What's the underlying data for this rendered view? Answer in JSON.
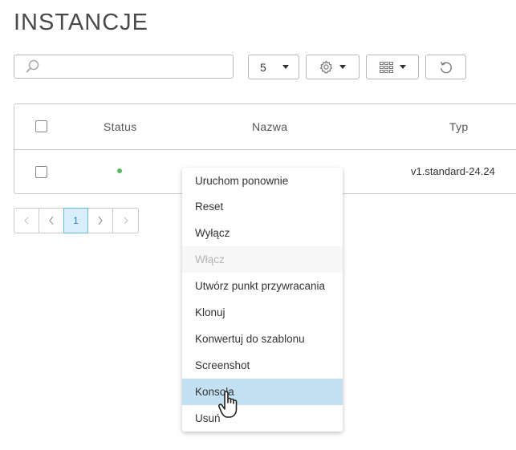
{
  "page": {
    "title": "INSTANCJE"
  },
  "toolbar": {
    "search_placeholder": "",
    "page_size": "5",
    "icons": [
      "search-icon",
      "gear-icon",
      "columns-icon",
      "refresh-icon"
    ]
  },
  "table": {
    "headers": [
      "Status",
      "Nazwa",
      "Typ"
    ],
    "rows": [
      {
        "status": "green",
        "name": "",
        "type": "v1.standard-24.24"
      }
    ]
  },
  "pagination": {
    "current": "1"
  },
  "menu": {
    "items": [
      {
        "label": "Uruchom ponownie",
        "state": "enabled"
      },
      {
        "label": "Reset",
        "state": "enabled"
      },
      {
        "label": "Wyłącz",
        "state": "enabled"
      },
      {
        "label": "Włącz",
        "state": "disabled"
      },
      {
        "label": "Utwórz punkt przywracania",
        "state": "enabled"
      },
      {
        "label": "Klonuj",
        "state": "enabled"
      },
      {
        "label": "Konwertuj do szablonu",
        "state": "enabled"
      },
      {
        "label": "Screenshot",
        "state": "enabled"
      },
      {
        "label": "Konsola",
        "state": "hover"
      },
      {
        "label": "Usuń",
        "state": "enabled"
      }
    ]
  },
  "colors": {
    "status_ok": "#5cb85c",
    "hover_bg": "#c3e1f3",
    "active_page_bg": "#d8eefa"
  }
}
